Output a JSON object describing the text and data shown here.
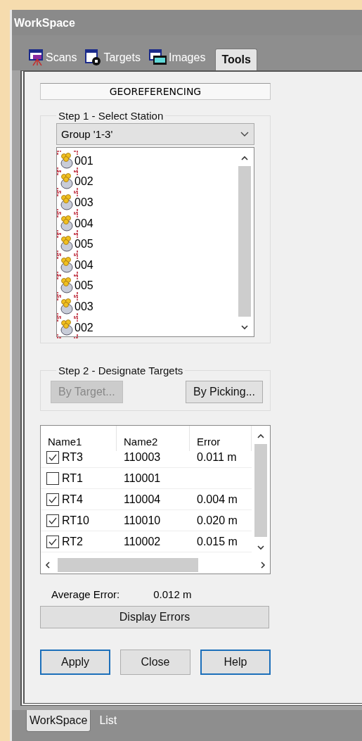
{
  "window": {
    "title": "WorkSpace"
  },
  "tabs": [
    {
      "label": "Scans",
      "kind": "scans",
      "selected": false
    },
    {
      "label": "Targets",
      "kind": "targets",
      "selected": false
    },
    {
      "label": "Images",
      "kind": "images",
      "selected": false
    },
    {
      "label": "Tools",
      "kind": "plain",
      "selected": true
    }
  ],
  "header": "GEOREFERENCING",
  "step1": {
    "title": "Step 1 - Select Station",
    "group": "Group '1-3'",
    "stations": [
      "001",
      "002",
      "003",
      "004",
      "005",
      "004",
      "005",
      "003",
      "002"
    ]
  },
  "step2": {
    "title": "Step 2 - Designate Targets",
    "buttons": [
      {
        "label": "By Target...",
        "disabled": true
      },
      {
        "label": "By Picking...",
        "disabled": false
      }
    ]
  },
  "table": {
    "columns": [
      "Name1",
      "Name2",
      "Error"
    ],
    "rows": [
      {
        "checked": true,
        "name1": "RT3",
        "name2": "110003",
        "error": "0.011 m"
      },
      {
        "checked": false,
        "name1": "RT1",
        "name2": "110001"
      },
      {
        "checked": true,
        "name1": "RT4",
        "name2": "110004",
        "error": "0.004 m"
      },
      {
        "checked": true,
        "name1": "RT10",
        "name2": "110010",
        "error": "0.020 m"
      },
      {
        "checked": true,
        "name1": "RT2",
        "name2": "110002",
        "error": "0.015 m"
      }
    ]
  },
  "average_error": {
    "label": "Average Error:",
    "value": "0.012 m"
  },
  "display_errors": "Display Errors",
  "buttons": [
    {
      "label": "Apply",
      "focused": true
    },
    {
      "label": "Close",
      "focused": false
    },
    {
      "label": "Help",
      "focused": true
    }
  ],
  "bottom_tabs": [
    {
      "label": "WorkSpace",
      "selected": true
    },
    {
      "label": "List",
      "selected": false
    }
  ]
}
